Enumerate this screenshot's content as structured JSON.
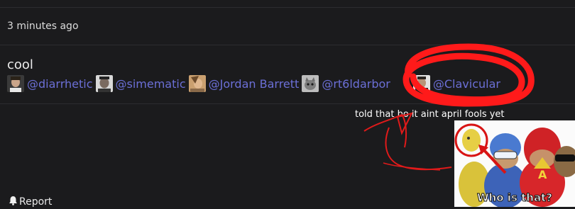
{
  "comment": {
    "timestamp": "3 minutes ago",
    "text": "cool"
  },
  "mentions": [
    {
      "handle": "@diarrhetic",
      "avatar": "avatar-person-icon"
    },
    {
      "handle": "@simematic",
      "avatar": "avatar-person-icon"
    },
    {
      "handle": "@Jordan Barrett",
      "avatar": "avatar-person-icon"
    },
    {
      "handle": "@rt6ldarbor",
      "avatar": "avatar-cat-icon"
    },
    {
      "handle": "@Clavicular",
      "avatar": "avatar-person-icon"
    }
  ],
  "annotation": {
    "caption": "told that bo it aint april fools yet",
    "color": "#ff1a1a"
  },
  "meme": {
    "caption": "Who is that?"
  },
  "report": {
    "label": "Report",
    "icon": "bell-icon"
  },
  "colors": {
    "background": "#1b1b1d",
    "mention": "#6b6fd6",
    "divider": "#2c2c30"
  }
}
